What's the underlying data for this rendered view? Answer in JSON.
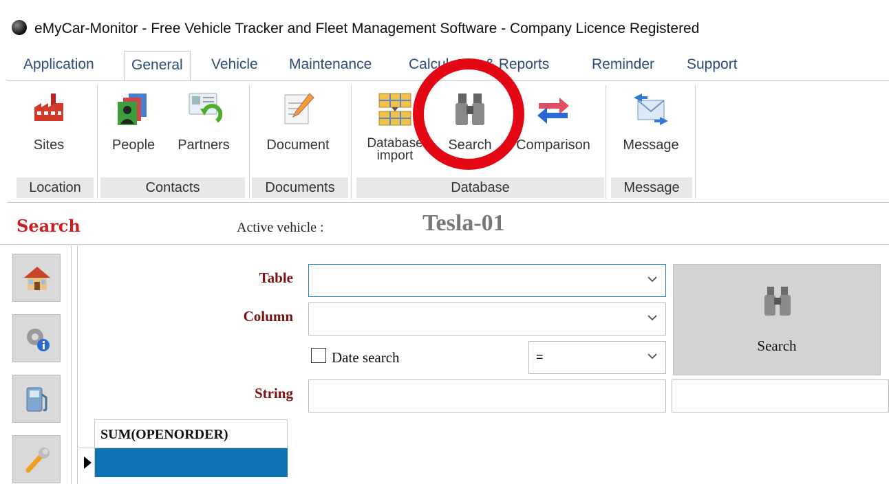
{
  "window": {
    "title": "eMyCar-Monitor - Free Vehicle Tracker and Fleet Management Software - Company Licence Registered"
  },
  "tabs": [
    {
      "label": "Application",
      "active": false
    },
    {
      "label": "General",
      "active": true
    },
    {
      "label": "Vehicle",
      "active": false
    },
    {
      "label": "Maintenance",
      "active": false
    },
    {
      "label": "Calculators & Reports",
      "active": false
    },
    {
      "label": "Reminder",
      "active": false
    },
    {
      "label": "Support",
      "active": false
    }
  ],
  "ribbon": {
    "groups": [
      {
        "label": "Location",
        "buttons": [
          {
            "label": "Sites",
            "icon": "factory-icon"
          }
        ]
      },
      {
        "label": "Contacts",
        "buttons": [
          {
            "label": "People",
            "icon": "people-icon"
          },
          {
            "label": "Partners",
            "icon": "partners-icon"
          }
        ]
      },
      {
        "label": "Documents",
        "buttons": [
          {
            "label": "Document",
            "icon": "document-edit-icon"
          }
        ]
      },
      {
        "label": "Database",
        "buttons": [
          {
            "label": "Database import",
            "icon": "database-import-icon"
          },
          {
            "label": "Search",
            "icon": "binoculars-icon"
          },
          {
            "label": "Comparison",
            "icon": "compare-arrows-icon"
          }
        ]
      },
      {
        "label": "Message",
        "buttons": [
          {
            "label": "Message",
            "icon": "envelope-icon"
          }
        ]
      }
    ],
    "highlight_color": "#e30613"
  },
  "page": {
    "title": "Search",
    "active_vehicle_label": "Active vehicle :",
    "active_vehicle_value": "Tesla-01"
  },
  "sidebar": {
    "buttons": [
      {
        "icon": "home-icon"
      },
      {
        "icon": "settings-info-icon"
      },
      {
        "icon": "fuel-pump-icon"
      },
      {
        "icon": "wrench-icon"
      }
    ]
  },
  "form": {
    "table_label": "Table",
    "table_value": "",
    "column_label": "Column",
    "column_value": "",
    "date_search_label": "Date search",
    "date_search_checked": false,
    "operator_value": "=",
    "string_label": "String",
    "string_value": "",
    "string_value2": "",
    "search_button_label": "Search"
  },
  "grid": {
    "columns": [
      "SUM(OPENORDER)"
    ],
    "rows": [
      [
        ""
      ]
    ],
    "selected_row_color": "#0f72b5"
  }
}
